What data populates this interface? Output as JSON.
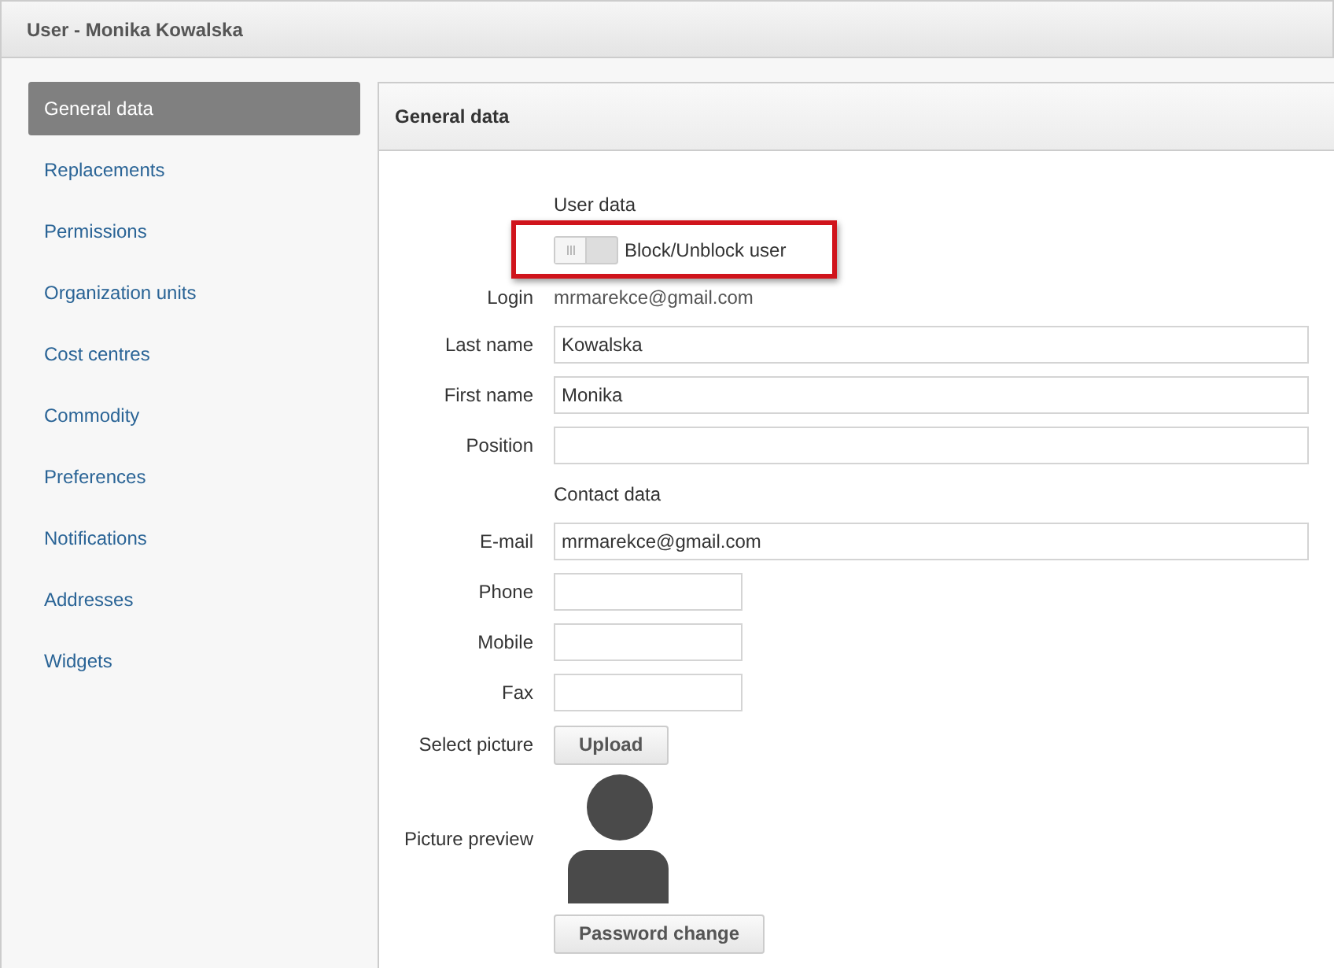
{
  "window": {
    "title": "User - Monika Kowalska"
  },
  "sidebar": {
    "items": [
      {
        "label": "General data",
        "selected": true
      },
      {
        "label": "Replacements",
        "selected": false
      },
      {
        "label": "Permissions",
        "selected": false
      },
      {
        "label": "Organization units",
        "selected": false
      },
      {
        "label": "Cost centres",
        "selected": false
      },
      {
        "label": "Commodity",
        "selected": false
      },
      {
        "label": "Preferences",
        "selected": false
      },
      {
        "label": "Notifications",
        "selected": false
      },
      {
        "label": "Addresses",
        "selected": false
      },
      {
        "label": "Widgets",
        "selected": false
      }
    ]
  },
  "panel": {
    "title": "General data",
    "rows": [
      {
        "kind": "heading",
        "text": "User data"
      },
      {
        "kind": "toggle",
        "label": "Block/Unblock user",
        "on": false,
        "highlighted": true
      },
      {
        "kind": "static",
        "label": "Login",
        "value": "mrmarekce@gmail.com"
      },
      {
        "kind": "field",
        "label": "Last name",
        "value": "Kowalska"
      },
      {
        "kind": "field",
        "label": "First name",
        "value": "Monika"
      },
      {
        "kind": "field",
        "label": "Position"
      },
      {
        "kind": "heading",
        "text": "Contact data"
      },
      {
        "kind": "field",
        "label": "E-mail",
        "value": "mrmarekce@gmail.com"
      },
      {
        "kind": "shortfield",
        "label": "Phone"
      },
      {
        "kind": "shortfield",
        "label": "Mobile"
      },
      {
        "kind": "shortfield",
        "label": "Fax"
      },
      {
        "kind": "button",
        "label": "Select picture",
        "button": "Upload"
      },
      {
        "kind": "avatar",
        "label": "Picture preview"
      },
      {
        "kind": "button",
        "button": "Password change"
      }
    ]
  }
}
